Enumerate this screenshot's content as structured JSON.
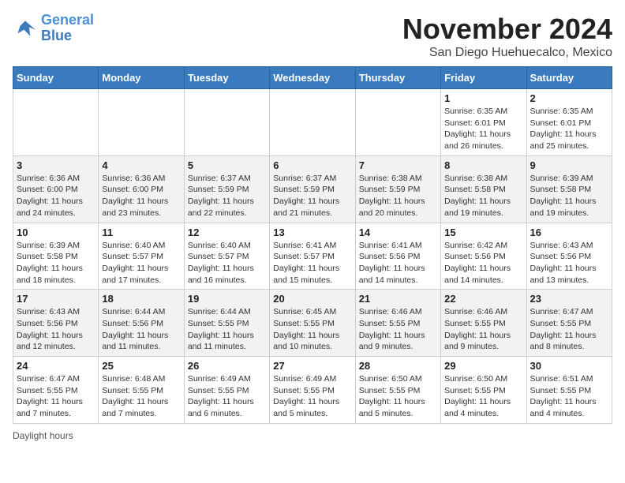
{
  "header": {
    "logo_line1": "General",
    "logo_line2": "Blue",
    "month_title": "November 2024",
    "subtitle": "San Diego Huehuecalco, Mexico"
  },
  "days_of_week": [
    "Sunday",
    "Monday",
    "Tuesday",
    "Wednesday",
    "Thursday",
    "Friday",
    "Saturday"
  ],
  "weeks": [
    [
      {
        "day": "",
        "info": ""
      },
      {
        "day": "",
        "info": ""
      },
      {
        "day": "",
        "info": ""
      },
      {
        "day": "",
        "info": ""
      },
      {
        "day": "",
        "info": ""
      },
      {
        "day": "1",
        "info": "Sunrise: 6:35 AM\nSunset: 6:01 PM\nDaylight: 11 hours and 26 minutes."
      },
      {
        "day": "2",
        "info": "Sunrise: 6:35 AM\nSunset: 6:01 PM\nDaylight: 11 hours and 25 minutes."
      }
    ],
    [
      {
        "day": "3",
        "info": "Sunrise: 6:36 AM\nSunset: 6:00 PM\nDaylight: 11 hours and 24 minutes."
      },
      {
        "day": "4",
        "info": "Sunrise: 6:36 AM\nSunset: 6:00 PM\nDaylight: 11 hours and 23 minutes."
      },
      {
        "day": "5",
        "info": "Sunrise: 6:37 AM\nSunset: 5:59 PM\nDaylight: 11 hours and 22 minutes."
      },
      {
        "day": "6",
        "info": "Sunrise: 6:37 AM\nSunset: 5:59 PM\nDaylight: 11 hours and 21 minutes."
      },
      {
        "day": "7",
        "info": "Sunrise: 6:38 AM\nSunset: 5:59 PM\nDaylight: 11 hours and 20 minutes."
      },
      {
        "day": "8",
        "info": "Sunrise: 6:38 AM\nSunset: 5:58 PM\nDaylight: 11 hours and 19 minutes."
      },
      {
        "day": "9",
        "info": "Sunrise: 6:39 AM\nSunset: 5:58 PM\nDaylight: 11 hours and 19 minutes."
      }
    ],
    [
      {
        "day": "10",
        "info": "Sunrise: 6:39 AM\nSunset: 5:58 PM\nDaylight: 11 hours and 18 minutes."
      },
      {
        "day": "11",
        "info": "Sunrise: 6:40 AM\nSunset: 5:57 PM\nDaylight: 11 hours and 17 minutes."
      },
      {
        "day": "12",
        "info": "Sunrise: 6:40 AM\nSunset: 5:57 PM\nDaylight: 11 hours and 16 minutes."
      },
      {
        "day": "13",
        "info": "Sunrise: 6:41 AM\nSunset: 5:57 PM\nDaylight: 11 hours and 15 minutes."
      },
      {
        "day": "14",
        "info": "Sunrise: 6:41 AM\nSunset: 5:56 PM\nDaylight: 11 hours and 14 minutes."
      },
      {
        "day": "15",
        "info": "Sunrise: 6:42 AM\nSunset: 5:56 PM\nDaylight: 11 hours and 14 minutes."
      },
      {
        "day": "16",
        "info": "Sunrise: 6:43 AM\nSunset: 5:56 PM\nDaylight: 11 hours and 13 minutes."
      }
    ],
    [
      {
        "day": "17",
        "info": "Sunrise: 6:43 AM\nSunset: 5:56 PM\nDaylight: 11 hours and 12 minutes."
      },
      {
        "day": "18",
        "info": "Sunrise: 6:44 AM\nSunset: 5:56 PM\nDaylight: 11 hours and 11 minutes."
      },
      {
        "day": "19",
        "info": "Sunrise: 6:44 AM\nSunset: 5:55 PM\nDaylight: 11 hours and 11 minutes."
      },
      {
        "day": "20",
        "info": "Sunrise: 6:45 AM\nSunset: 5:55 PM\nDaylight: 11 hours and 10 minutes."
      },
      {
        "day": "21",
        "info": "Sunrise: 6:46 AM\nSunset: 5:55 PM\nDaylight: 11 hours and 9 minutes."
      },
      {
        "day": "22",
        "info": "Sunrise: 6:46 AM\nSunset: 5:55 PM\nDaylight: 11 hours and 9 minutes."
      },
      {
        "day": "23",
        "info": "Sunrise: 6:47 AM\nSunset: 5:55 PM\nDaylight: 11 hours and 8 minutes."
      }
    ],
    [
      {
        "day": "24",
        "info": "Sunrise: 6:47 AM\nSunset: 5:55 PM\nDaylight: 11 hours and 7 minutes."
      },
      {
        "day": "25",
        "info": "Sunrise: 6:48 AM\nSunset: 5:55 PM\nDaylight: 11 hours and 7 minutes."
      },
      {
        "day": "26",
        "info": "Sunrise: 6:49 AM\nSunset: 5:55 PM\nDaylight: 11 hours and 6 minutes."
      },
      {
        "day": "27",
        "info": "Sunrise: 6:49 AM\nSunset: 5:55 PM\nDaylight: 11 hours and 5 minutes."
      },
      {
        "day": "28",
        "info": "Sunrise: 6:50 AM\nSunset: 5:55 PM\nDaylight: 11 hours and 5 minutes."
      },
      {
        "day": "29",
        "info": "Sunrise: 6:50 AM\nSunset: 5:55 PM\nDaylight: 11 hours and 4 minutes."
      },
      {
        "day": "30",
        "info": "Sunrise: 6:51 AM\nSunset: 5:55 PM\nDaylight: 11 hours and 4 minutes."
      }
    ]
  ],
  "footer": {
    "daylight_label": "Daylight hours"
  }
}
